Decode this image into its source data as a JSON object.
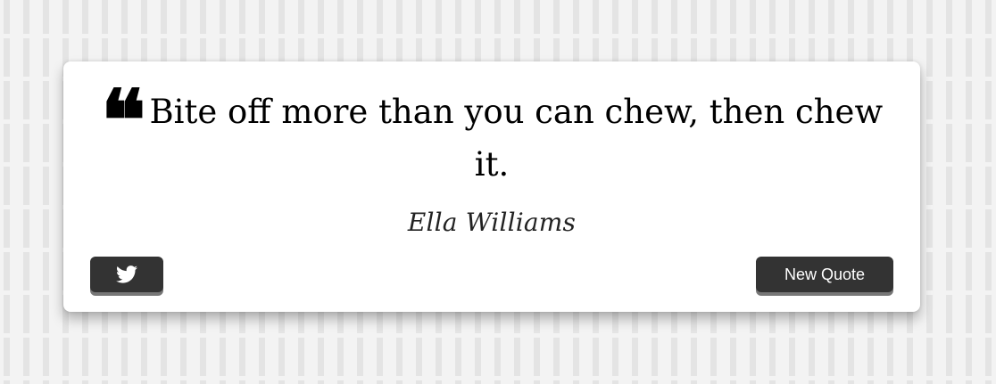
{
  "quote": {
    "mark": "❝",
    "text": "Bite off more than you can chew, then chew it.",
    "author": "Ella Williams"
  },
  "buttons": {
    "tweet_icon": "twitter-bird-icon",
    "new_quote_label": "New Quote"
  },
  "colors": {
    "background": "#f3f3f3",
    "pattern": "#e4e4e4",
    "card": "#ffffff",
    "button": "#333333",
    "button_shadow": "#777777",
    "text": "#000000"
  }
}
